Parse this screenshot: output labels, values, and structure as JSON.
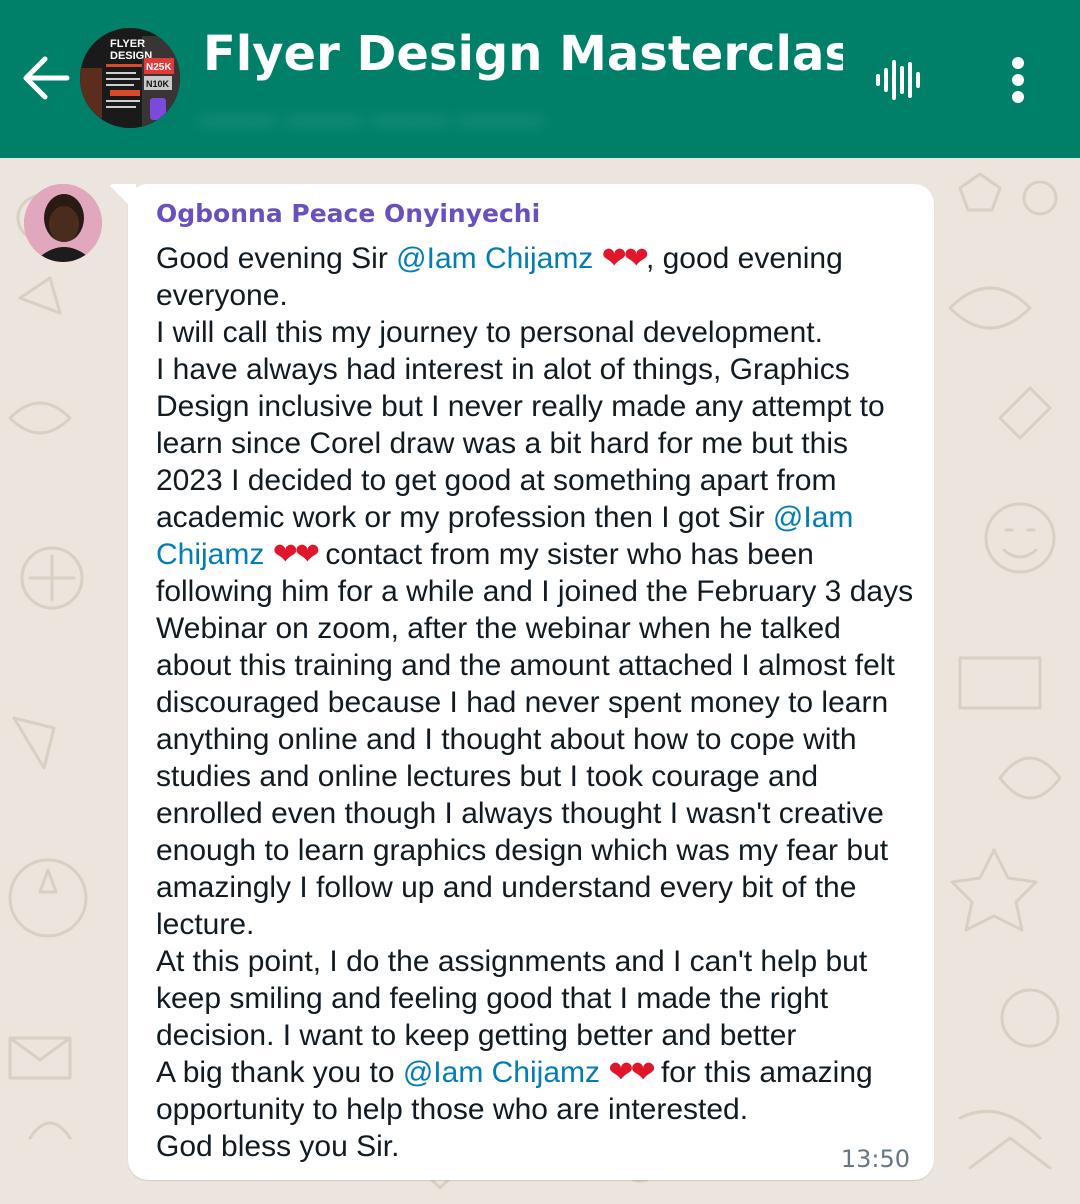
{
  "chat": {
    "title": "Flyer Design Masterclass (...",
    "subtitle": "........ ........ ........ .........",
    "group_avatar": {
      "line1": "FLYER",
      "line2": "DESIGN",
      "badge1": "N25K",
      "badge2": "N10K"
    }
  },
  "message": {
    "sender": "Ogbonna Peace Onyinyechi",
    "time": "13:50",
    "hearts": "❤❤",
    "mention_name": "@Iam Chijamz",
    "mention_part1": "@Iam",
    "mention_part2": "Chijamz",
    "parts": {
      "p1_a": "Good evening Sir ",
      "p1_b": ", good evening everyone.",
      "p2": "I will call this my journey to personal development.",
      "p3_a": "I have always had interest in alot of things, Graphics Design inclusive but I never really made any attempt to learn since Corel draw was a bit hard for me but this 2023 I decided to get good at something apart from academic work or my profession then I got Sir ",
      "p3_b": " contact from my sister who has been following him for a while and I joined the February 3 days Webinar on zoom, after the webinar when he talked about this training and the amount attached I almost felt discouraged because I had never spent money to learn anything online and I thought about how to cope with studies and online lectures but I took courage and enrolled even though I always thought I wasn't creative enough to learn graphics design which was my fear but amazingly I follow up and understand every bit of the lecture.",
      "p4": "At this point, I do the assignments and I can't help but keep smiling and feeling good that I made the right decision. I want to keep getting better and better",
      "p5_a": "A big thank you to ",
      "p5_b": " for this amazing opportunity to help those who are interested.",
      "p6": "God bless you Sir."
    }
  },
  "colors": {
    "header": "#008069",
    "wallpaper": "#ece5dd",
    "bubble": "#ffffff",
    "sender_name": "#6a4fbf",
    "mention": "#027eb5",
    "heart": "#e0172b",
    "time": "#667781"
  },
  "icons": {
    "back": "arrow-left-icon",
    "voice": "voice-call-waveform-icon",
    "menu": "more-vertical-icon"
  }
}
